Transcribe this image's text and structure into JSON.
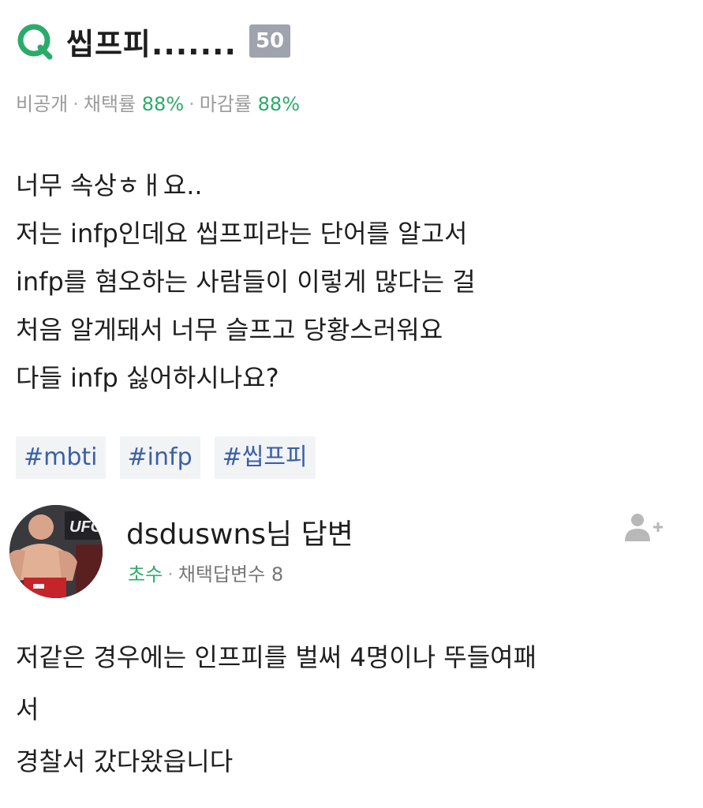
{
  "question": {
    "title": "씹프피.......",
    "badge": "50",
    "meta": {
      "visibility": "비공개",
      "adoption_label": "채택률",
      "adoption_value": "88%",
      "closing_label": "마감률",
      "closing_value": "88%",
      "separator": "·"
    },
    "body_lines": [
      "너무 속상ㅎㅐ요..",
      "저는 infp인데요 씹프피라는 단어를 알고서",
      "infp를 혐오하는 사람들이 이렇게 많다는 걸",
      "처음 알게돼서 너무 슬프고 당황스러워요",
      "다들 infp 싫어하시나요?"
    ],
    "tags": [
      "#mbti",
      "#infp",
      "#씹프피"
    ]
  },
  "answer": {
    "author": "dsduswns님 답변",
    "level": "초수",
    "separator": "·",
    "adopted_label": "채택답변수",
    "adopted_count": "8",
    "body_lines": [
      "저같은 경우에는 인프피를 벌써 4명이나 뚜들여패",
      "서",
      "경찰서 갔다왔읍니다"
    ]
  },
  "icons": {
    "search": "q-logo-icon",
    "add_friend": "add-friend-icon",
    "avatar": "avatar-image"
  },
  "colors": {
    "brand_green": "#2bab6a",
    "badge_gray": "#9fa3ad",
    "tag_text": "#3a5fa8",
    "tag_bg": "#f2f3f5"
  }
}
